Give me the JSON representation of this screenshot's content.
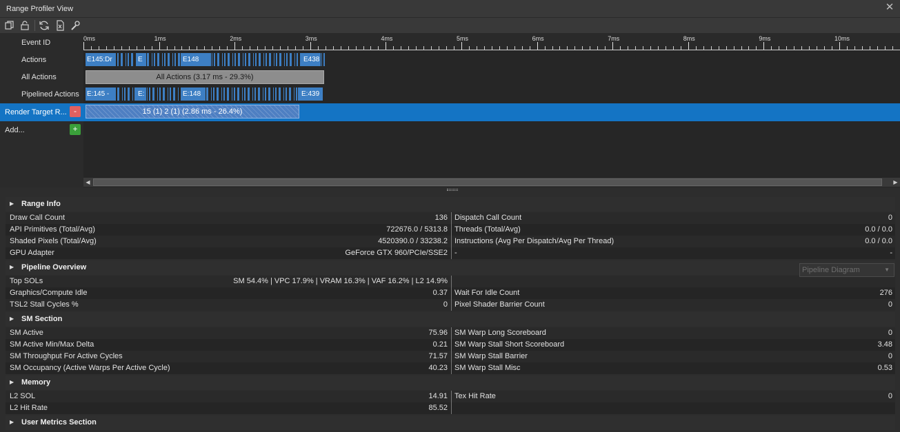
{
  "window": {
    "title": "Range Profiler View",
    "close_glyph": "✕"
  },
  "toolbar": {
    "icons": [
      "copy-icon",
      "lock-icon",
      "refresh-icon",
      "export-icon",
      "settings-wrench-icon"
    ]
  },
  "timeline": {
    "ticks": [
      "0ms",
      "1ms",
      "2ms",
      "3ms",
      "4ms",
      "5ms",
      "6ms",
      "7ms",
      "8ms",
      "9ms",
      "10ms"
    ],
    "rows": {
      "event_id": "Event ID",
      "actions": "Actions",
      "all_actions": "All Actions",
      "pipelined_actions": "Pipelined Actions",
      "render_target": "Render Target R...",
      "add": "Add..."
    },
    "actions_labels": [
      "E145:Dr",
      "E",
      "E148",
      "E438"
    ],
    "pipelined_labels": [
      "E:145 -",
      "E:",
      "E:148",
      "E:439"
    ],
    "all_actions_bar": "All Actions (3.17 ms - 29.3%)",
    "render_target_bar": "15 (1) 2 (1) (2.86 ms - 26.4%)",
    "remove_glyph": "-",
    "add_glyph": "+",
    "colors": {
      "action_blue": "#3d7fc4",
      "selection": "#1474c4",
      "remove_red": "#e06060",
      "add_green": "#3aa03a"
    }
  },
  "range_info": {
    "title": "Range Info",
    "left": [
      {
        "label": "Draw Call Count",
        "value": "136"
      },
      {
        "label": "API Primitives (Total/Avg)",
        "value": "722676.0 / 5313.8"
      },
      {
        "label": "Shaded Pixels (Total/Avg)",
        "value": "4520390.0 / 33238.2"
      },
      {
        "label": "GPU Adapter",
        "value": "GeForce GTX 960/PCIe/SSE2"
      }
    ],
    "right": [
      {
        "label": "Dispatch Call Count",
        "value": "0"
      },
      {
        "label": "Threads (Total/Avg)",
        "value": "0.0 / 0.0"
      },
      {
        "label": "Instructions (Avg Per Dispatch/Avg Per Thread)",
        "value": "0.0 / 0.0"
      },
      {
        "label": "-",
        "value": "-"
      }
    ]
  },
  "pipeline_overview": {
    "title": "Pipeline Overview",
    "dropdown": "Pipeline Diagram",
    "left": [
      {
        "label": "Top SOLs",
        "value": "SM 54.4% | VPC 17.9% | VRAM 16.3% | VAF 16.2% | L2 14.9%"
      },
      {
        "label": "Graphics/Compute Idle",
        "value": "0.37"
      },
      {
        "label": "TSL2 Stall Cycles %",
        "value": "0"
      }
    ],
    "right": [
      {
        "label": "",
        "value": ""
      },
      {
        "label": "Wait For Idle Count",
        "value": "276"
      },
      {
        "label": "Pixel Shader Barrier Count",
        "value": "0"
      }
    ]
  },
  "sm_section": {
    "title": "SM Section",
    "left": [
      {
        "label": "SM Active",
        "value": "75.96"
      },
      {
        "label": "SM Active Min/Max Delta",
        "value": "0.21"
      },
      {
        "label": "SM Throughput For Active Cycles",
        "value": "71.57"
      },
      {
        "label": "SM Occupancy (Active Warps Per Active Cycle)",
        "value": "40.23"
      }
    ],
    "right": [
      {
        "label": "SM Warp Long Scoreboard",
        "value": "0"
      },
      {
        "label": "SM Warp Stall Short Scoreboard",
        "value": "3.48"
      },
      {
        "label": "SM Warp Stall Barrier",
        "value": "0"
      },
      {
        "label": "SM Warp Stall Misc",
        "value": "0.53"
      }
    ]
  },
  "memory": {
    "title": "Memory",
    "left": [
      {
        "label": "L2 SOL",
        "value": "14.91"
      },
      {
        "label": "L2 Hit Rate",
        "value": "85.52"
      }
    ],
    "right": [
      {
        "label": "Tex Hit Rate",
        "value": "0"
      },
      {
        "label": "",
        "value": ""
      }
    ]
  },
  "user_metrics": {
    "title": "User Metrics Section"
  }
}
